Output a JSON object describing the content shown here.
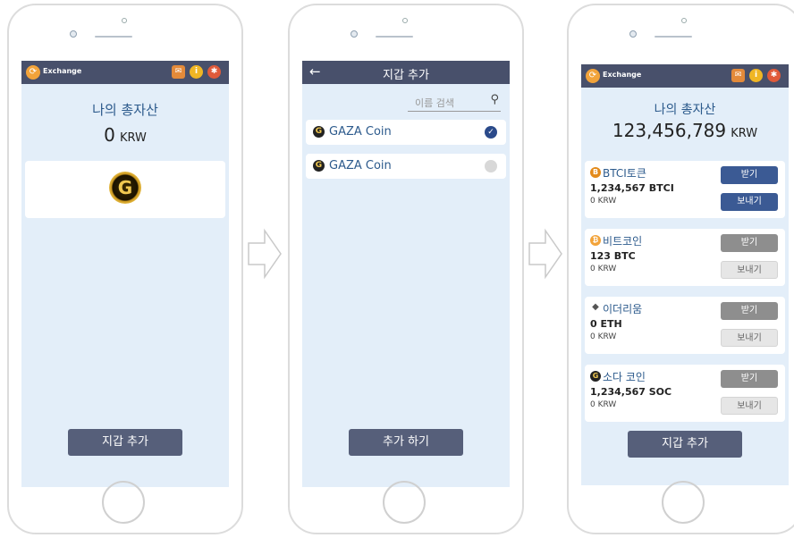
{
  "screen1": {
    "app_name": "Exchange",
    "total_title": "나의 총자산",
    "total_amount": "0",
    "currency": "KRW",
    "add_wallet_button": "지갑 추가"
  },
  "screen2": {
    "title": "지갑 추가",
    "search_placeholder": "이름 검색",
    "coins": [
      {
        "name": "GAZA Coin",
        "checked": true
      },
      {
        "name": "GAZA Coin",
        "checked": false
      }
    ],
    "add_button": "추가 하기"
  },
  "screen3": {
    "app_name": "Exchange",
    "total_title": "나의 총자산",
    "total_amount": "123,456,789",
    "currency": "KRW",
    "wallets": [
      {
        "name": "BTCI토큰",
        "balance": "1,234,567 BTCI",
        "krw": "0 KRW",
        "receive": "받기",
        "send": "보내기",
        "icon": "btci-icon"
      },
      {
        "name": "비트코인",
        "balance": "123 BTC",
        "krw": "0 KRW",
        "receive": "받기",
        "send": "보내기",
        "icon": "bitcoin-icon"
      },
      {
        "name": "이더리움",
        "balance": "0 ETH",
        "krw": "0 KRW",
        "receive": "받기",
        "send": "보내기",
        "icon": "ethereum-icon"
      },
      {
        "name": "소다 코인",
        "balance": "1,234,567 SOC",
        "krw": "0 KRW",
        "receive": "받기",
        "send": "보내기",
        "icon": "soda-coin-icon"
      }
    ],
    "add_wallet_button": "지갑 추가"
  },
  "colors": {
    "header": "#48506b",
    "screen_bg": "#e3eef9",
    "accent": "#2c5a8c",
    "button_dark": "#3b5a94"
  }
}
